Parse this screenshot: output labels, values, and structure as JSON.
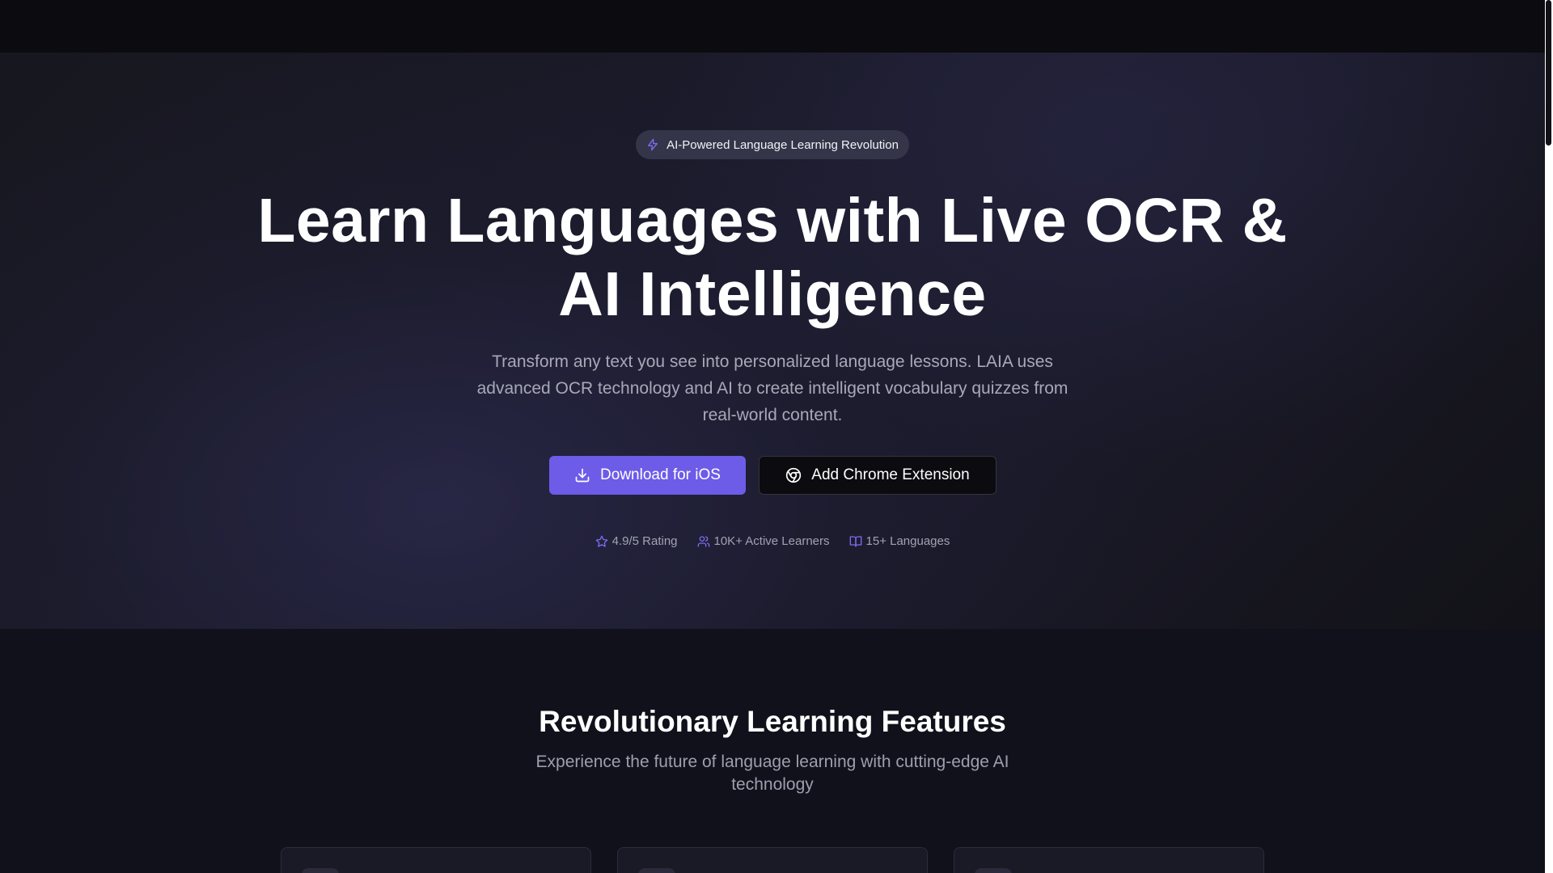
{
  "badge": {
    "icon": "lightning-icon",
    "text": "AI-Powered Language Learning Revolution"
  },
  "hero": {
    "title_line1": "Learn Languages with Live OCR &",
    "title_line2": "AI Intelligence",
    "subtitle_line1": "Transform any text you see into personalized language lessons. LAIA uses",
    "subtitle_line2": "advanced OCR technology and AI to create intelligent vocabulary quizzes from",
    "subtitle_line3": "real-world content."
  },
  "buttons": {
    "ios_label": "Download for iOS",
    "ios_icon": "download-icon",
    "chrome_label": "Add Chrome Extension",
    "chrome_icon": "chrome-icon"
  },
  "stats": [
    {
      "icon": "star-icon",
      "label": "4.9/5 Rating"
    },
    {
      "icon": "users-icon",
      "label": "10K+ Active Learners"
    },
    {
      "icon": "book-icon",
      "label": "15+ Languages"
    }
  ],
  "features": {
    "title": "Revolutionary Learning Features",
    "subtitle_line1": "Experience the future of language learning with cutting-edge AI",
    "subtitle_line2": "technology"
  },
  "colors": {
    "accent": "#6c5ce7",
    "accent_icon": "#7c6cf0",
    "background": "#0c0c12"
  }
}
